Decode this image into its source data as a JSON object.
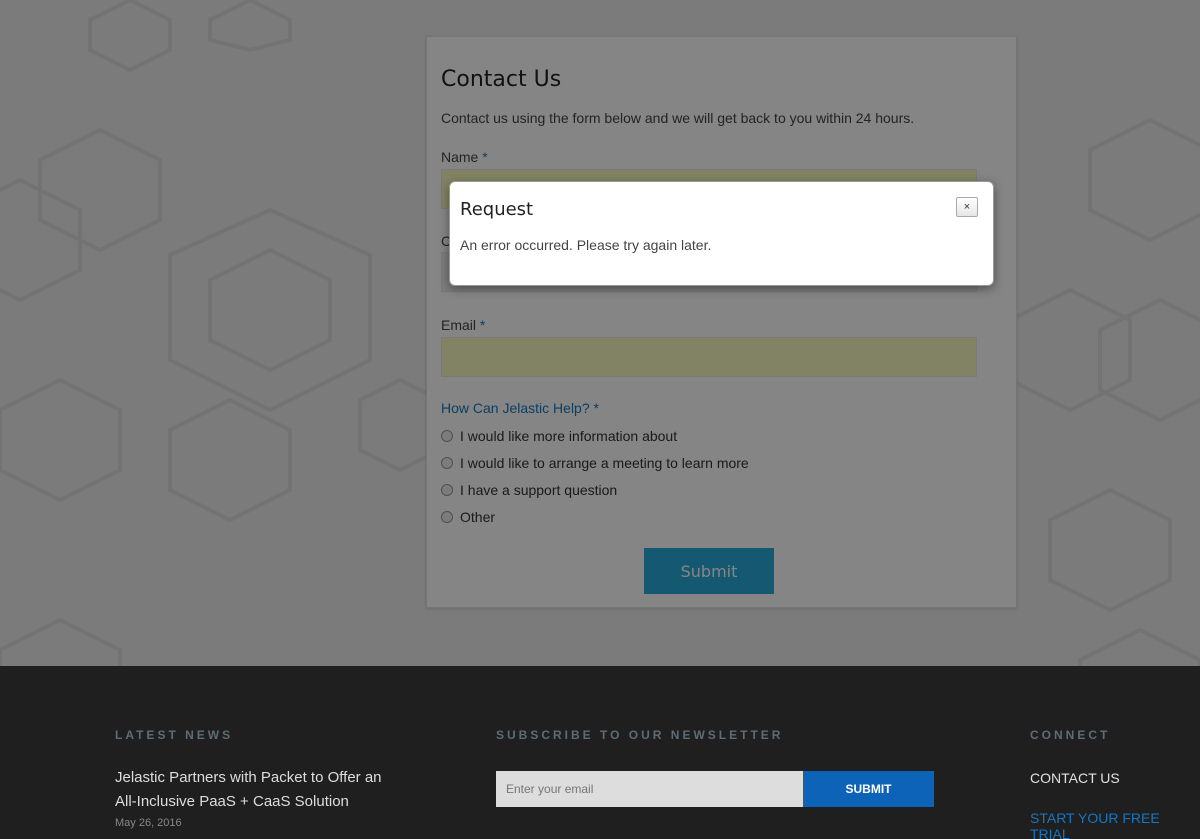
{
  "form": {
    "title": "Contact Us",
    "intro": "Contact us using the form below and we will get back to you within 24 hours.",
    "name_label": "Name",
    "company_label_partial": "C",
    "email_label": "Email",
    "required_mark": "*",
    "help_label": "How Can Jelastic Help? *",
    "options": [
      "I would like more information about",
      "I would like to arrange a meeting to learn more",
      "I have a support question",
      "Other"
    ],
    "submit_label": "Submit"
  },
  "modal": {
    "title": "Request",
    "close_label": "×",
    "message": "An error occurred. Please try again later."
  },
  "footer": {
    "news_heading": "LATEST NEWS",
    "news_title": "Jelastic Partners with Packet to Offer an All-Inclusive PaaS + CaaS Solution",
    "news_date": "May 26, 2016",
    "newsletter_heading": "SUBSCRIBE TO OUR NEWSLETTER",
    "newsletter_placeholder": "Enter your email",
    "newsletter_submit": "SUBMIT",
    "connect_heading": "CONNECT",
    "contact_link": "CONTACT US",
    "trial_link": "START YOUR FREE TRIAL"
  },
  "colors": {
    "accent": "#1a75bb",
    "submit": "#2aa9da",
    "highlight_input": "#fafcc0",
    "footer_bg": "#1f1f1f",
    "newsletter_button": "#0d63b8"
  }
}
